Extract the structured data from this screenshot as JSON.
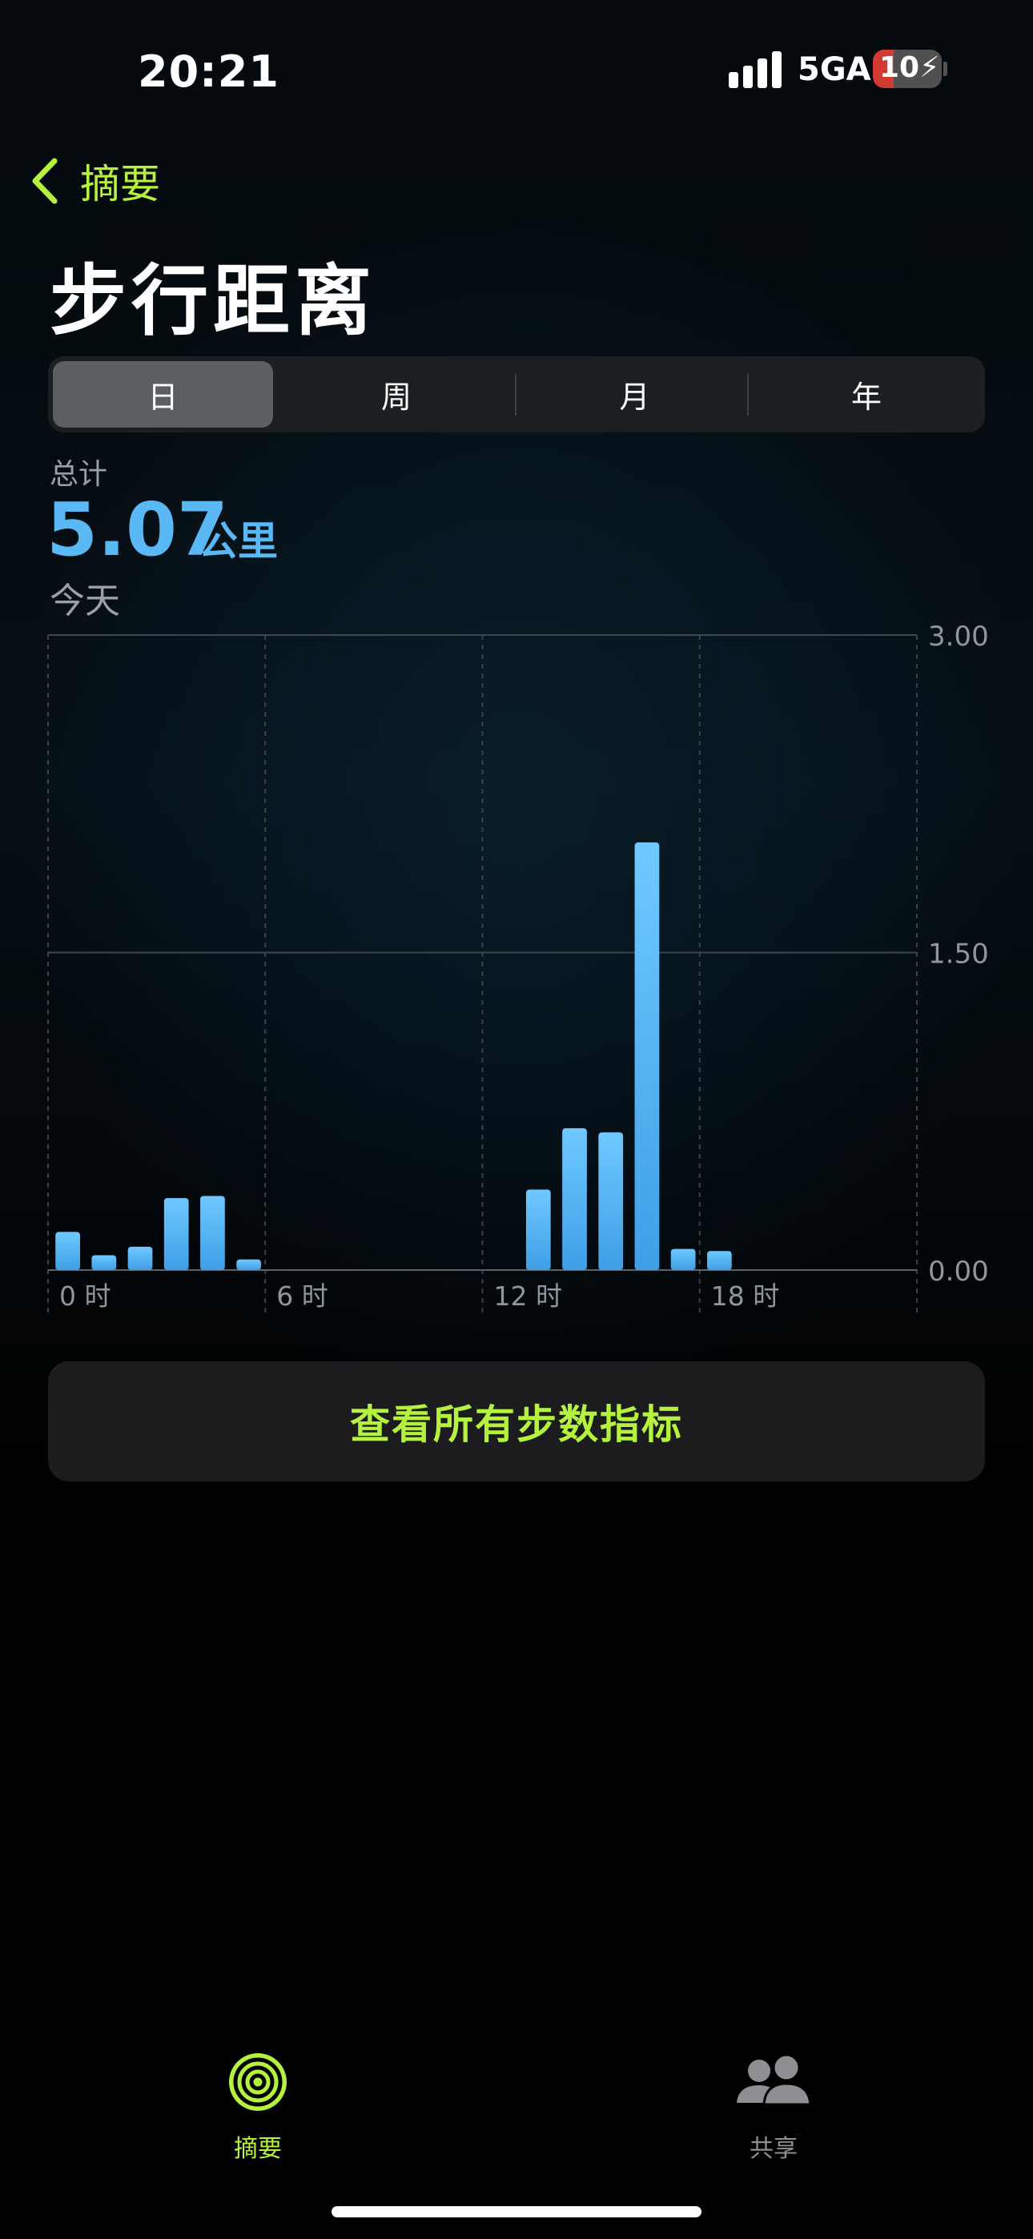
{
  "status_bar": {
    "time": "20:21",
    "network": "5GA",
    "battery": "10",
    "battery_level": 0.1,
    "icons": [
      "signal-icon",
      "battery-charging-icon"
    ]
  },
  "nav": {
    "back_label": "摘要",
    "back_icon": "chevron-left-icon",
    "title": "步行距离"
  },
  "segments": [
    {
      "label": "日",
      "selected": true
    },
    {
      "label": "周",
      "selected": false
    },
    {
      "label": "月",
      "selected": false
    },
    {
      "label": "年",
      "selected": false
    }
  ],
  "summary": {
    "total_label": "总计",
    "value": "5.07",
    "unit": "公里",
    "period": "今天"
  },
  "chart_data": {
    "type": "bar",
    "x": [
      0,
      1,
      2,
      3,
      4,
      5,
      13,
      14,
      15,
      16,
      17,
      18
    ],
    "values": [
      0.18,
      0.07,
      0.11,
      0.34,
      0.35,
      0.05,
      0.38,
      0.67,
      0.65,
      2.02,
      0.1,
      0.09
    ],
    "xlim": [
      0,
      24
    ],
    "ylim": [
      0,
      3
    ],
    "x_ticks": [
      "0 时",
      "6 时",
      "12 时",
      "18 时"
    ],
    "y_ticks": [
      "0.00",
      "1.50",
      "3.00"
    ],
    "bar_color": "#5ab8f5",
    "grid": true
  },
  "action_button": "查看所有步数指标",
  "tab_bar": {
    "summary": {
      "label": "摘要",
      "icon": "activity-rings-icon",
      "active": true
    },
    "sharing": {
      "label": "共享",
      "icon": "people-icon",
      "active": false
    }
  },
  "colors": {
    "accent": "#b5f23d",
    "bar": "#5ab8f5",
    "inactive": "#8e8e93"
  }
}
